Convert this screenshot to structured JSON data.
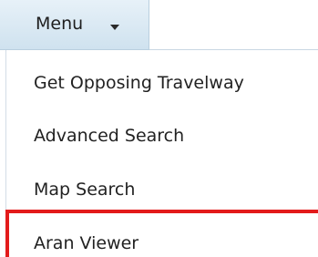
{
  "menu": {
    "label": "Menu",
    "chevron_icon": "chevron-down-icon"
  },
  "dropdown": {
    "items": [
      {
        "label": "Get Opposing Travelway"
      },
      {
        "label": "Advanced Search"
      },
      {
        "label": "Map Search"
      },
      {
        "label": "Aran Viewer"
      }
    ]
  },
  "colors": {
    "highlight_border": "#e31b1b",
    "menu_button_bg": "#d7e8f4"
  }
}
